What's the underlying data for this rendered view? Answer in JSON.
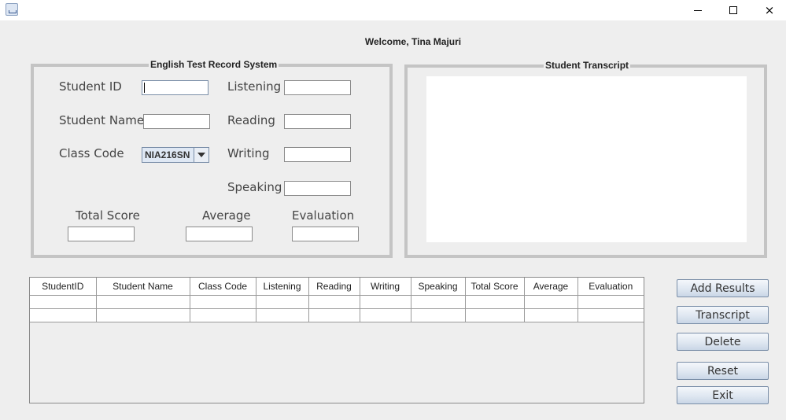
{
  "window": {
    "icon": "java-cup-icon",
    "controls": {
      "minimize": "minimize-icon",
      "maximize": "maximize-icon",
      "close": "×"
    }
  },
  "welcome": "Welcome, Tina Majuri",
  "record_panel": {
    "title": "English Test Record System",
    "labels": {
      "student_id": "Student ID",
      "student_name": "Student Name",
      "class_code": "Class Code",
      "listening": "Listening",
      "reading": "Reading",
      "writing": "Writing",
      "speaking": "Speaking",
      "total_score": "Total Score",
      "average": "Average",
      "evaluation": "Evaluation"
    },
    "values": {
      "student_id": "",
      "student_name": "",
      "class_code": "NIA216SN",
      "listening": "",
      "reading": "",
      "writing": "",
      "speaking": "",
      "total_score": "",
      "average": "",
      "evaluation": ""
    }
  },
  "transcript_panel": {
    "title": "Student Transcript",
    "content": ""
  },
  "table": {
    "columns": [
      "StudentID",
      "Student Name",
      "Class Code",
      "Listening",
      "Reading",
      "Writing",
      "Speaking",
      "Total Score",
      "Average",
      "Evaluation"
    ],
    "rows": [
      [
        "",
        "",
        "",
        "",
        "",
        "",
        "",
        "",
        "",
        ""
      ],
      [
        "",
        "",
        "",
        "",
        "",
        "",
        "",
        "",
        "",
        ""
      ]
    ]
  },
  "buttons": {
    "add_results": "Add Results",
    "transcript": "Transcript",
    "delete": "Delete",
    "reset": "Reset",
    "exit": "Exit"
  },
  "colors": {
    "background": "#eeeeee",
    "group_border": "#c4c4c4",
    "button_border": "#7a8ea8"
  }
}
